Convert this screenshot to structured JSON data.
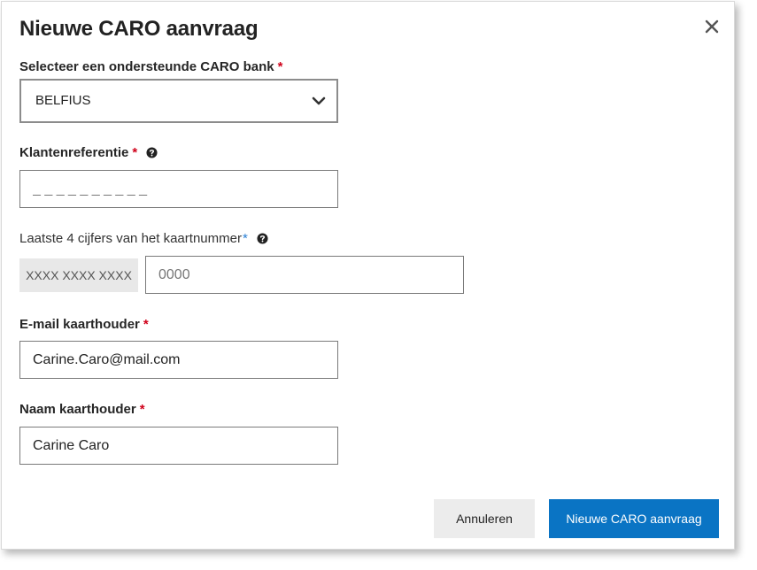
{
  "dialog": {
    "title": "Nieuwe CARO aanvraag",
    "close_icon": "close-icon"
  },
  "bank": {
    "label": "Selecteer een ondersteunde CARO bank",
    "required": "*",
    "selected": "BELFIUS",
    "icon": "chevron-down-icon"
  },
  "client_reference": {
    "label": "Klantenreferentie",
    "required": "*",
    "help_icon": "question-circle-icon",
    "placeholder": "_ _ _ _ _ _ _ _ _ _",
    "value": ""
  },
  "card_number": {
    "label": "Laatste 4 cijfers van het kaartnummer",
    "required": "*",
    "help_icon": "question-circle-icon",
    "masked_prefix": "XXXX XXXX XXXX",
    "placeholder": "0000",
    "value": ""
  },
  "email": {
    "label": "E-mail kaarthouder",
    "required": "*",
    "value": "Carine.Caro@mail.com"
  },
  "name": {
    "label": "Naam kaarthouder",
    "required": "*",
    "value": "Carine Caro"
  },
  "buttons": {
    "cancel": "Annuleren",
    "submit": "Nieuwe CARO aanvraag"
  },
  "colors": {
    "primary": "#0a74c4",
    "required": "#d0021b",
    "required_alt": "#2a7fd4",
    "secondary_button": "#ececec"
  }
}
